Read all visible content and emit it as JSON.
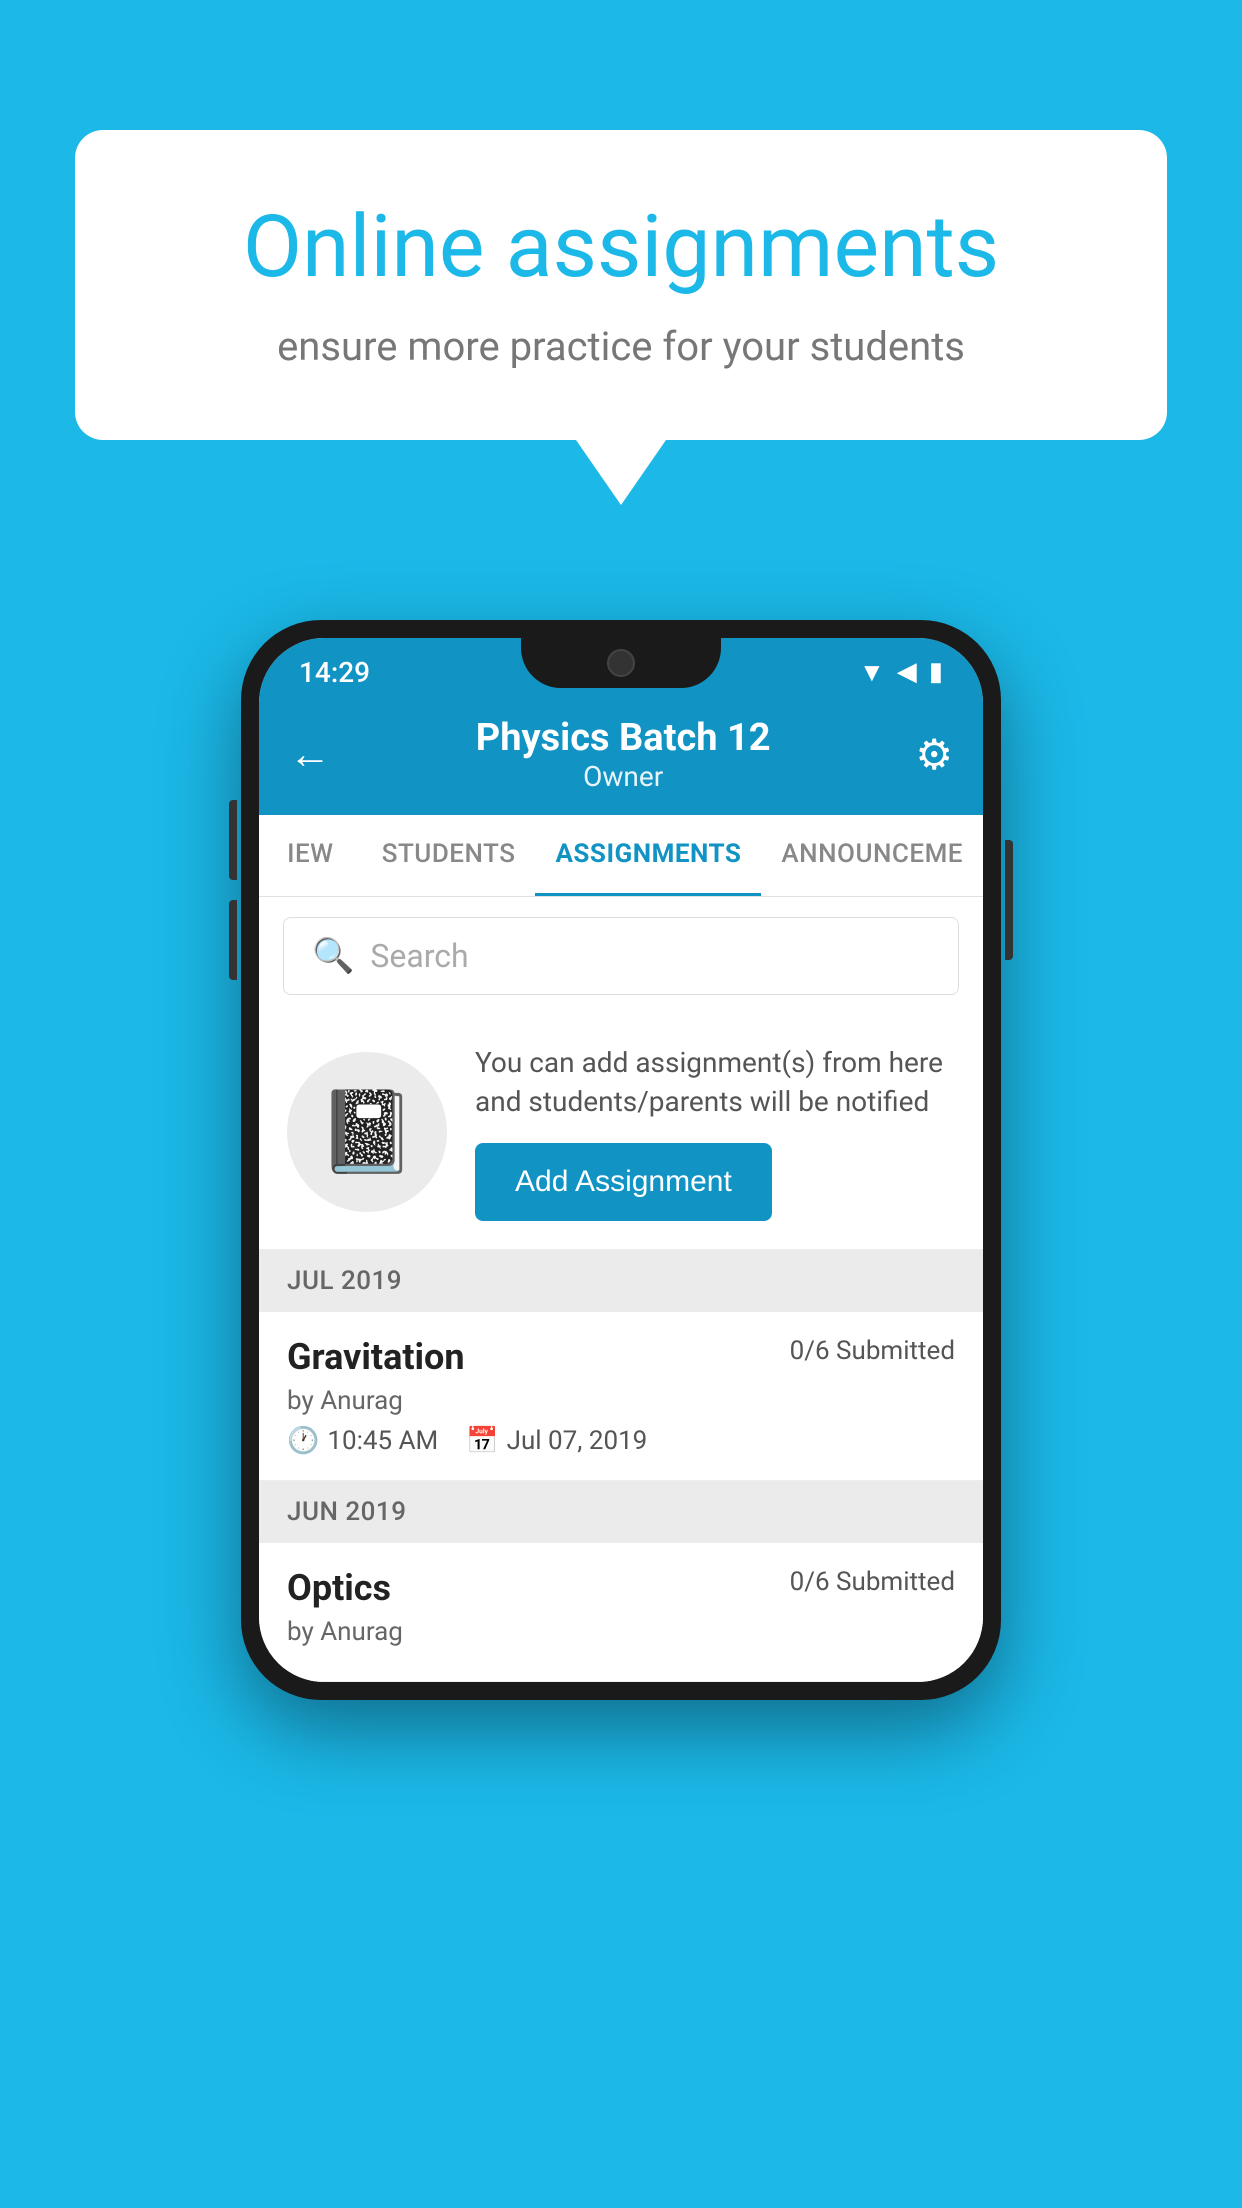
{
  "background": {
    "color": "#1bb8e8"
  },
  "speech_bubble": {
    "title": "Online assignments",
    "subtitle": "ensure more practice for your students"
  },
  "phone": {
    "status_bar": {
      "time": "14:29",
      "icons": "▼◀▮"
    },
    "header": {
      "back_label": "←",
      "title": "Physics Batch 12",
      "subtitle": "Owner",
      "gear_label": "⚙"
    },
    "tabs": [
      {
        "label": "IEW",
        "active": false
      },
      {
        "label": "STUDENTS",
        "active": false
      },
      {
        "label": "ASSIGNMENTS",
        "active": true
      },
      {
        "label": "ANNOUNCEME",
        "active": false
      }
    ],
    "search": {
      "placeholder": "Search"
    },
    "add_assignment": {
      "description": "You can add assignment(s) from here and students/parents will be notified",
      "button_label": "Add Assignment"
    },
    "sections": [
      {
        "month_label": "JUL 2019",
        "assignments": [
          {
            "name": "Gravitation",
            "submitted": "0/6 Submitted",
            "by": "by Anurag",
            "time": "10:45 AM",
            "date": "Jul 07, 2019"
          }
        ]
      },
      {
        "month_label": "JUN 2019",
        "assignments": [
          {
            "name": "Optics",
            "submitted": "0/6 Submitted",
            "by": "by Anurag",
            "time": "",
            "date": ""
          }
        ]
      }
    ]
  }
}
